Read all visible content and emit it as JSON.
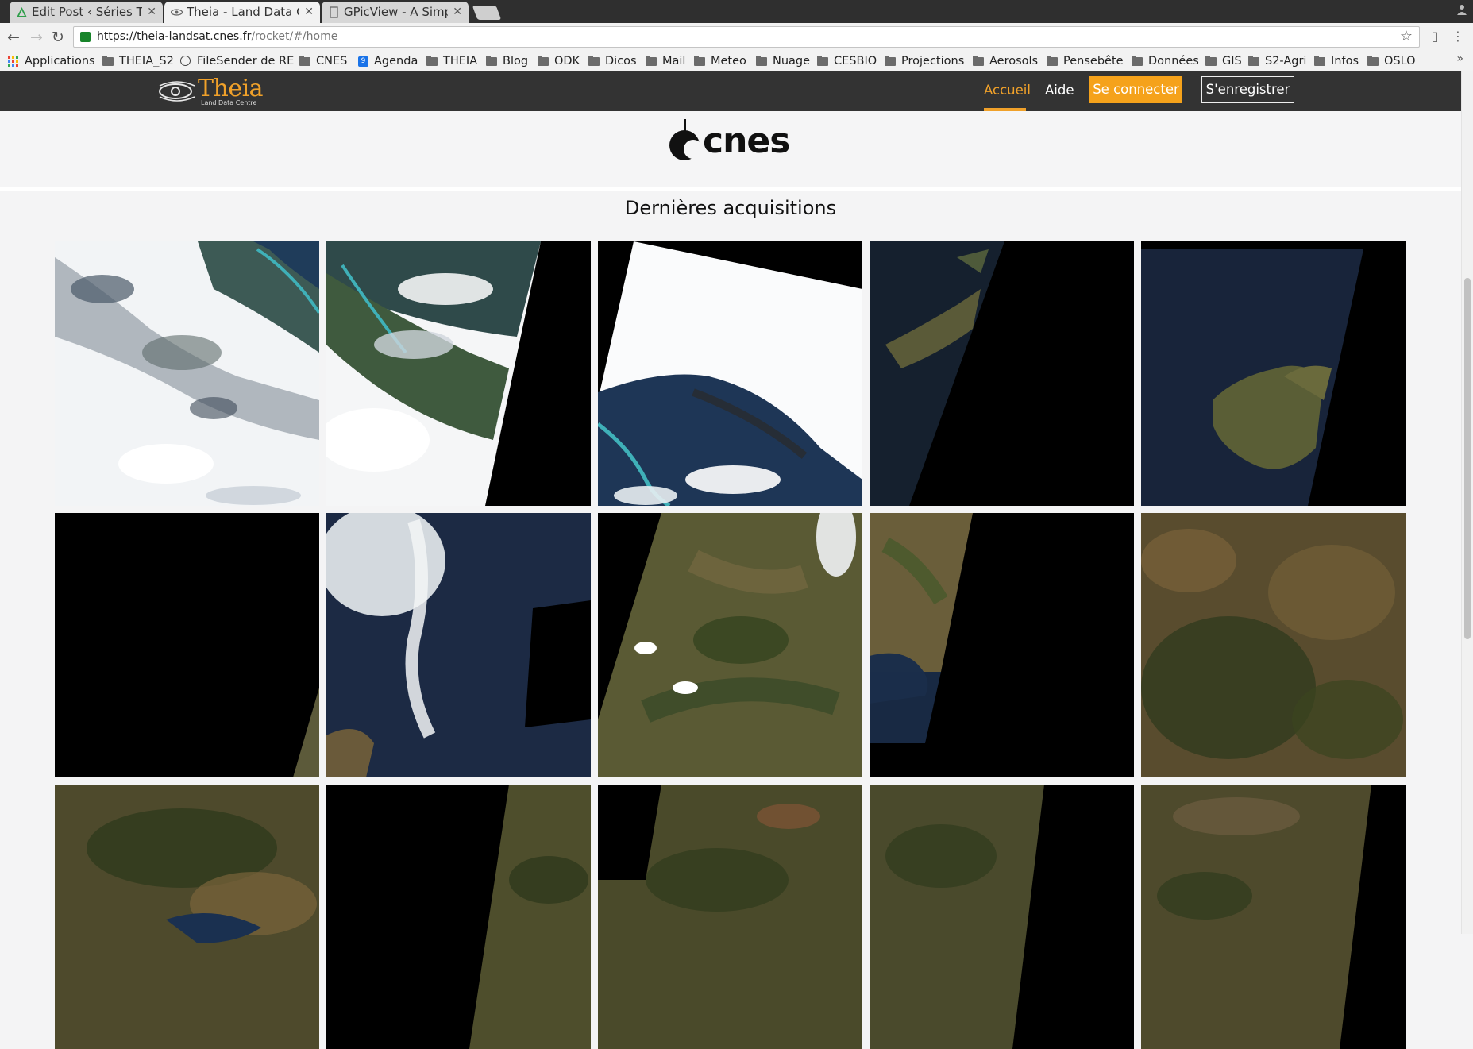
{
  "browser": {
    "tabs": [
      {
        "label": "Edit Post ‹ Séries Te",
        "icon": "wordpress-icon",
        "active": false
      },
      {
        "label": "Theia - Land Data C",
        "icon": "theia-eye-icon",
        "active": true
      },
      {
        "label": "GPicView - A Simple",
        "icon": "page-icon",
        "active": false
      }
    ],
    "url_host": "https://theia-landsat.cnes.fr",
    "url_path": "/rocket/#/home",
    "bookmarks": [
      {
        "label": "Applications",
        "icon": "apps-grid-icon"
      },
      {
        "label": "THEIA_S2",
        "icon": "folder-icon"
      },
      {
        "label": "FileSender de RE",
        "icon": "filesender-icon"
      },
      {
        "label": "CNES",
        "icon": "folder-icon"
      },
      {
        "label": "Agenda",
        "icon": "calendar-icon"
      },
      {
        "label": "THEIA",
        "icon": "folder-icon"
      },
      {
        "label": "Blog",
        "icon": "folder-icon"
      },
      {
        "label": "ODK",
        "icon": "folder-icon"
      },
      {
        "label": "Dicos",
        "icon": "folder-icon"
      },
      {
        "label": "Mail",
        "icon": "folder-icon"
      },
      {
        "label": "Meteo",
        "icon": "folder-icon"
      },
      {
        "label": "Nuage",
        "icon": "folder-icon"
      },
      {
        "label": "CESBIO",
        "icon": "folder-icon"
      },
      {
        "label": "Projections",
        "icon": "folder-icon"
      },
      {
        "label": "Aerosols",
        "icon": "folder-icon"
      },
      {
        "label": "Pensebête",
        "icon": "folder-icon"
      },
      {
        "label": "Données",
        "icon": "folder-icon"
      },
      {
        "label": "GIS",
        "icon": "folder-icon"
      },
      {
        "label": "S2-Agri",
        "icon": "folder-icon"
      },
      {
        "label": "Infos",
        "icon": "folder-icon"
      },
      {
        "label": "OSLO",
        "icon": "folder-icon"
      }
    ],
    "bookmarks_more": "»",
    "calendar_badge": "9"
  },
  "site": {
    "logo_text": "Theia",
    "logo_subtitle": "Land Data Centre",
    "nav": {
      "home": "Accueil",
      "help": "Aide",
      "login": "Se connecter",
      "register": "S'enregistrer"
    },
    "accent_color": "#f0a12a",
    "partner_logo_text": "cnes",
    "section_title": "Dernières acquisitions"
  },
  "acquisitions": [
    {
      "scene": "cloudy-coast"
    },
    {
      "scene": "cloudy-coast-swath-edge"
    },
    {
      "scene": "cloud-cover-coast"
    },
    {
      "scene": "sea-peninsula-swath"
    },
    {
      "scene": "corsica-island-swath"
    },
    {
      "scene": "empty-swath-edge"
    },
    {
      "scene": "sea-cloud-plume"
    },
    {
      "scene": "land-swath-left"
    },
    {
      "scene": "land-coast-swath"
    },
    {
      "scene": "full-land"
    },
    {
      "scene": "land-coast-lake"
    },
    {
      "scene": "land-swath-right"
    },
    {
      "scene": "land-swath-right"
    },
    {
      "scene": "land-swath-right"
    },
    {
      "scene": "land-swath-right"
    }
  ]
}
